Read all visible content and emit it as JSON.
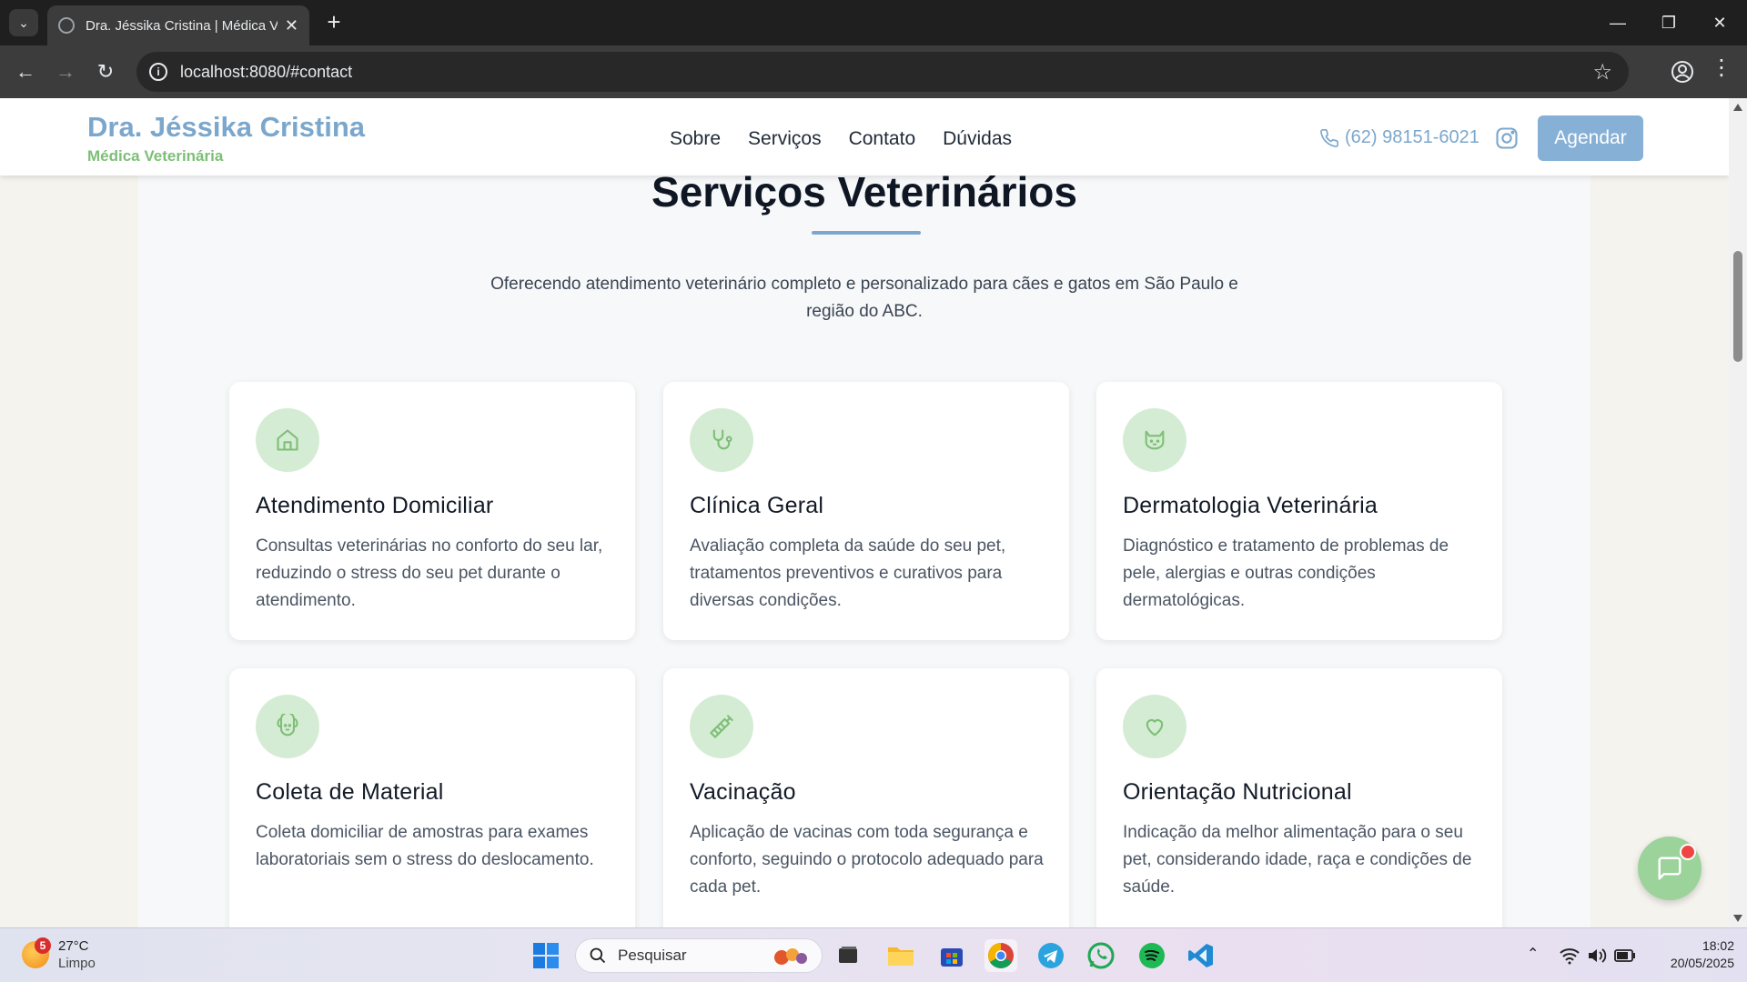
{
  "browser": {
    "tab_title": "Dra. Jéssika Cristina | Médica Ve",
    "url": "localhost:8080/#contact"
  },
  "header": {
    "brand_name": "Dra. Jéssika Cristina",
    "brand_sub": "Médica Veterinária",
    "nav": [
      "Sobre",
      "Serviços",
      "Contato",
      "Dúvidas"
    ],
    "phone": "(62) 98151-6021",
    "cta": "Agendar"
  },
  "services": {
    "title": "Serviços Veterinários",
    "description": "Oferecendo atendimento veterinário completo e personalizado para cães e gatos em São Paulo e região do ABC.",
    "cards": [
      {
        "icon": "house-icon",
        "title": "Atendimento Domiciliar",
        "text": "Consultas veterinárias no conforto do seu lar, reduzindo o stress do seu pet durante o atendimento."
      },
      {
        "icon": "stethoscope-icon",
        "title": "Clínica Geral",
        "text": "Avaliação completa da saúde do seu pet, tratamentos preventivos e curativos para diversas condições."
      },
      {
        "icon": "cat-icon",
        "title": "Dermatologia Veterinária",
        "text": "Diagnóstico e tratamento de problemas de pele, alergias e outras condições dermatológicas."
      },
      {
        "icon": "dog-icon",
        "title": "Coleta de Material",
        "text": "Coleta domiciliar de amostras para exames laboratoriais sem o stress do deslocamento."
      },
      {
        "icon": "syringe-icon",
        "title": "Vacinação",
        "text": "Aplicação de vacinas com toda segurança e conforto, seguindo o protocolo adequado para cada pet."
      },
      {
        "icon": "heart-icon",
        "title": "Orientação Nutricional",
        "text": "Indicação da melhor alimentação para o seu pet, considerando idade, raça e condições de saúde."
      }
    ]
  },
  "taskbar": {
    "weather_temp": "27°C",
    "weather_desc": "Limpo",
    "weather_badge": "5",
    "search_label": "Pesquisar",
    "time": "18:02",
    "date": "20/05/2025"
  },
  "colors": {
    "brand_blue": "#7ba7cc",
    "brand_green": "#7dbf76",
    "icon_circle": "#d5ecd4"
  }
}
